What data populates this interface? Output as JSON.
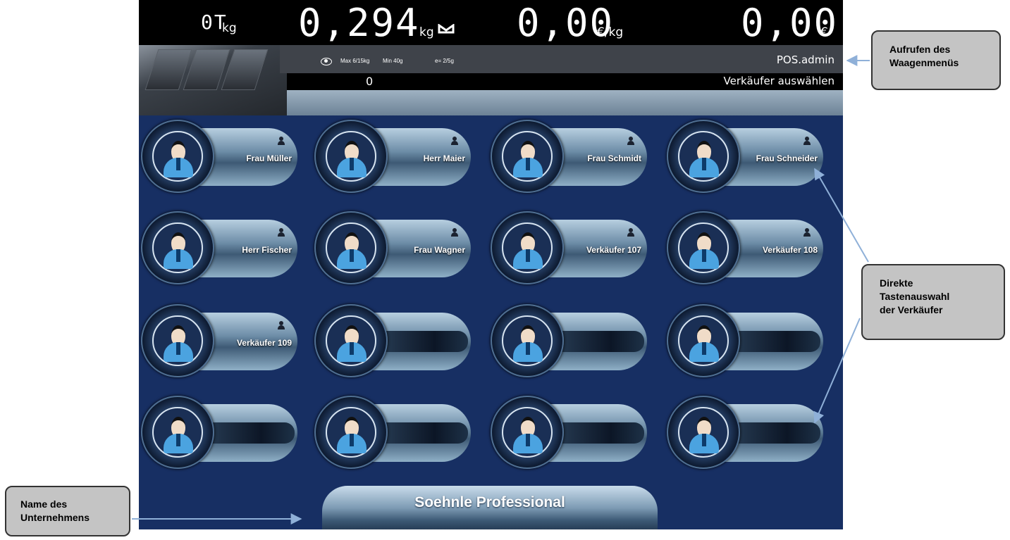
{
  "display": {
    "tare": "0T",
    "tare_unit": "kg",
    "weight": "0,294",
    "weight_unit": "kg",
    "unit_price": "0,00",
    "unit_price_unit": "€/kg",
    "total": "0,00",
    "total_unit": "€"
  },
  "info": {
    "max": "Max 6/15kg",
    "min": "Min 40g",
    "e": "e= 2/5g",
    "user": "POS.admin",
    "count": "0",
    "action": "Verkäufer auswählen"
  },
  "operators": [
    {
      "name": "Frau Müller"
    },
    {
      "name": "Herr Maier"
    },
    {
      "name": "Frau Schmidt"
    },
    {
      "name": "Frau Schneider"
    },
    {
      "name": "Herr Fischer"
    },
    {
      "name": "Frau Wagner"
    },
    {
      "name": "Verkäufer 107"
    },
    {
      "name": "Verkäufer 108"
    },
    {
      "name": "Verkäufer 109"
    },
    {
      "name": ""
    },
    {
      "name": ""
    },
    {
      "name": ""
    },
    {
      "name": ""
    },
    {
      "name": ""
    },
    {
      "name": ""
    },
    {
      "name": ""
    }
  ],
  "company": "Soehnle Professional",
  "callouts": {
    "menu_line1": "Aufrufen des",
    "menu_line2": "Waagenmenüs",
    "direct_line1": "Direkte",
    "direct_line2": "Tastenauswahl",
    "direct_line3": "der Verkäufer",
    "company_line1": "Name des",
    "company_line2": "Unternehmens"
  },
  "colors": {
    "background": "#172f63",
    "callout": "#c4c4c4",
    "arrow": "#8fb0d8"
  }
}
